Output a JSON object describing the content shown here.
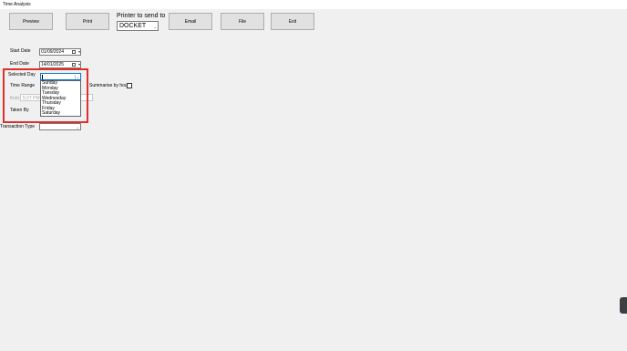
{
  "window": {
    "title": "Time Analysis"
  },
  "toolbar": {
    "preview": "Preview",
    "print": "Print",
    "printer_label": "Printer to send to",
    "printer_value": "DOCKET",
    "email": "Email",
    "file": "File",
    "exit": "Exit"
  },
  "form": {
    "start_date_label": "Start Date",
    "start_date_value": "01/09/2024",
    "end_date_label": "End Date",
    "end_date_value": "14/01/2025",
    "selected_day_label": "Selected Day",
    "time_range_label": "Time Range",
    "from_label": "from",
    "from_value": "5:27 PM",
    "summarise_label": "Summarise by hour",
    "taken_by_label": "Taken By",
    "transaction_type_label": "Transaction Type"
  },
  "day_options": [
    "Sunday",
    "Monday",
    "Tuesday",
    "Wednesday",
    "Thursday",
    "Friday",
    "Saturday"
  ]
}
